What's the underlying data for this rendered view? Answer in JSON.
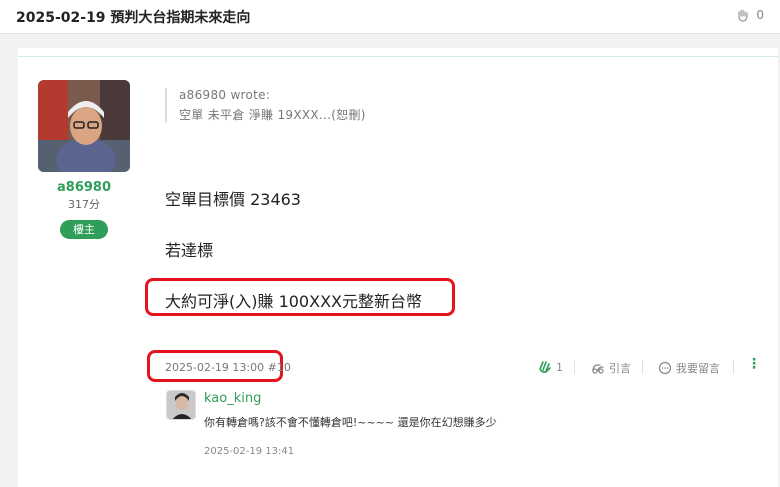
{
  "header": {
    "title": "2025-02-19 預判大台指期未來走向",
    "clap_count": "0",
    "clap_icon": "clap-icon"
  },
  "post": {
    "author": {
      "name": "a86980",
      "score": "317分",
      "badge": "樓主"
    },
    "quote": {
      "author_line": "a86980 wrote:",
      "text": "空單 未平倉 淨賺 19XXX...(恕刪)"
    },
    "body": {
      "line1": "空單目標價 23463",
      "line2": "若達標",
      "line3": "大約可淨(入)賺 100XXX元整新台幣"
    },
    "meta": {
      "datetime": "2025-02-19 13:00 #10"
    },
    "actions": {
      "like_count": "1",
      "quote_label": "引言",
      "reply_label": "我要留言"
    },
    "highlight_color": "#e3141c",
    "accent_color": "#2e9e58"
  },
  "comment": {
    "name": "kao_king",
    "text": "你有轉倉嗎?該不會不懂轉倉吧!~~~~ 還是你在幻想賺多少",
    "time": "2025-02-19 13:41"
  }
}
